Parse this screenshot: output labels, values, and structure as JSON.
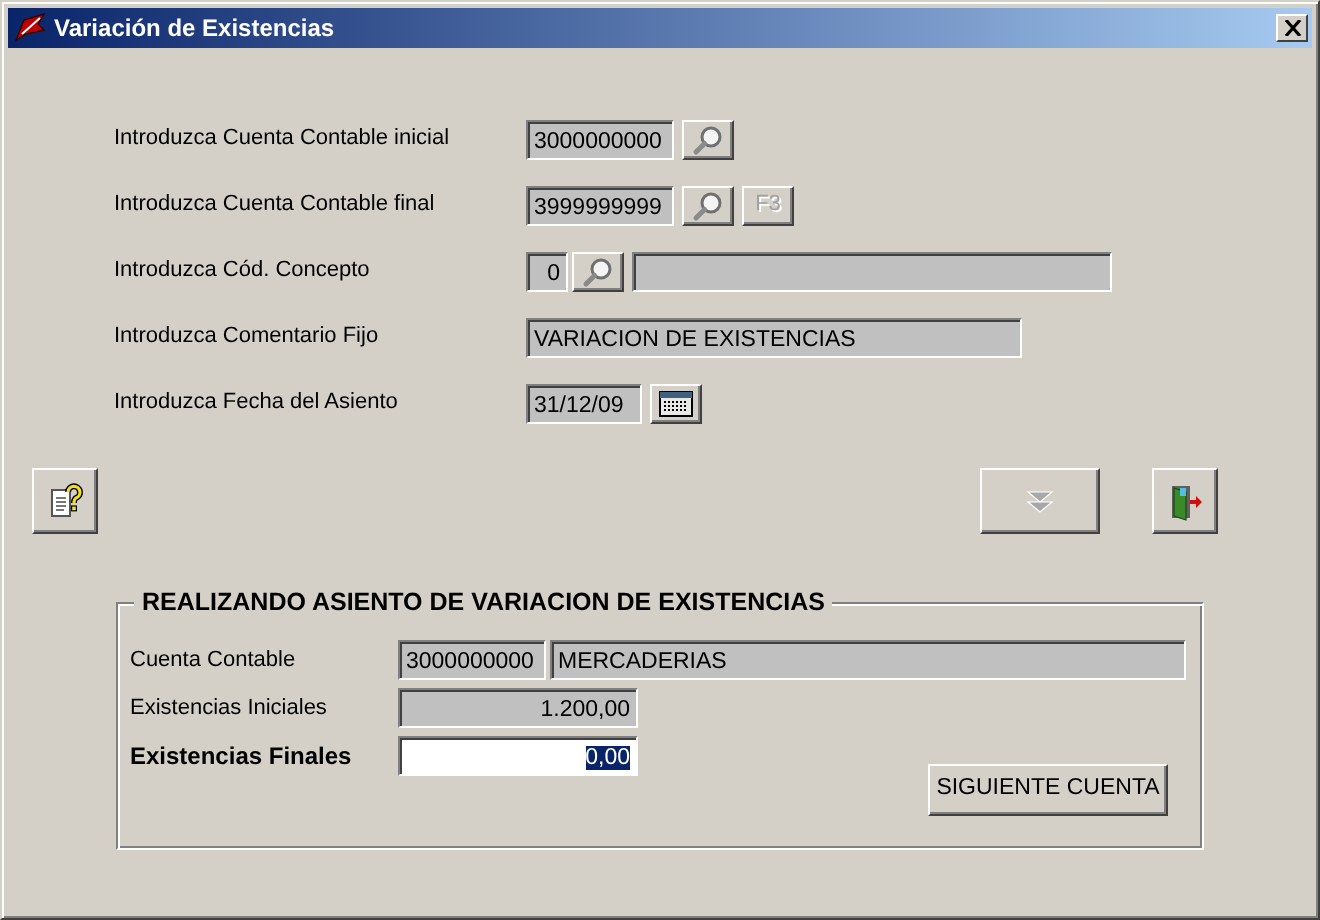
{
  "window": {
    "title": "Variación de Existencias"
  },
  "form_rows": [
    {
      "label": "Introduzca Cuenta Contable inicial",
      "items": [
        {
          "kind": "code",
          "value": "3000000000"
        },
        {
          "kind": "search"
        }
      ]
    },
    {
      "label": "Introduzca Cuenta Contable final",
      "items": [
        {
          "kind": "code",
          "value": "3999999999"
        },
        {
          "kind": "search"
        },
        {
          "kind": "key",
          "label": "F3",
          "disabled": true
        }
      ]
    },
    {
      "label": "Introduzca Cód. Concepto",
      "items": [
        {
          "kind": "digit",
          "value": "0"
        },
        {
          "kind": "search"
        },
        {
          "kind": "description"
        }
      ]
    },
    {
      "label": "Introduzca Comentario Fijo",
      "items": [
        {
          "kind": "comment",
          "value": "VARIACION DE EXISTENCIAS"
        }
      ]
    },
    {
      "label": "Introduzca Fecha del Asiento",
      "items": [
        {
          "kind": "date",
          "value": "31/12/09"
        },
        {
          "kind": "calendar"
        }
      ]
    }
  ],
  "toolbar": [
    {
      "kind": "help",
      "disabled": false
    },
    {
      "kind": "next",
      "disabled": true
    },
    {
      "kind": "exit",
      "disabled": false
    }
  ],
  "group": {
    "title": "REALIZANDO ASIENTO DE VARIACION DE EXISTENCIAS",
    "rows": [
      {
        "label": "Cuenta Contable",
        "bold": false,
        "fields": [
          {
            "kind": "code",
            "value": "3000000000"
          },
          {
            "kind": "name",
            "value": "MERCADERIAS"
          }
        ]
      },
      {
        "label": "Existencias Iniciales",
        "bold": false,
        "fields": [
          {
            "kind": "amount",
            "value": "1.200,00"
          }
        ]
      },
      {
        "label": "Existencias Finales",
        "bold": true,
        "fields": [
          {
            "kind": "input",
            "value": "0,00",
            "highlighted": true
          }
        ]
      }
    ],
    "button": "SIGUIENTE CUENTA"
  }
}
